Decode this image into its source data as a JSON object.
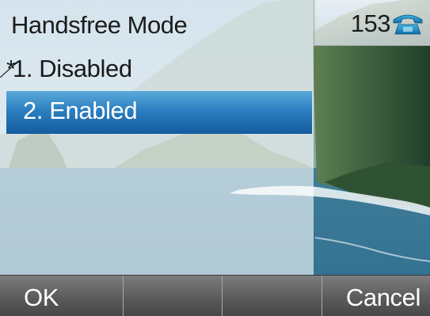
{
  "screen": {
    "title": "Handsfree Mode"
  },
  "menu": {
    "items": [
      {
        "mark": "*",
        "label": "1.  Disabled",
        "selected": false,
        "current": true
      },
      {
        "mark": "",
        "label": "2.  Enabled",
        "selected": true,
        "current": false
      }
    ]
  },
  "status": {
    "count": "153",
    "icon": "phone-icon"
  },
  "softkeys": [
    {
      "label": "OK"
    },
    {
      "label": ""
    },
    {
      "label": ""
    },
    {
      "label": "Cancel"
    }
  ],
  "colors": {
    "selection": "#2b7fc0",
    "softkey_bar": "#5e5e5e",
    "status_icon": "#1e7fb8"
  }
}
